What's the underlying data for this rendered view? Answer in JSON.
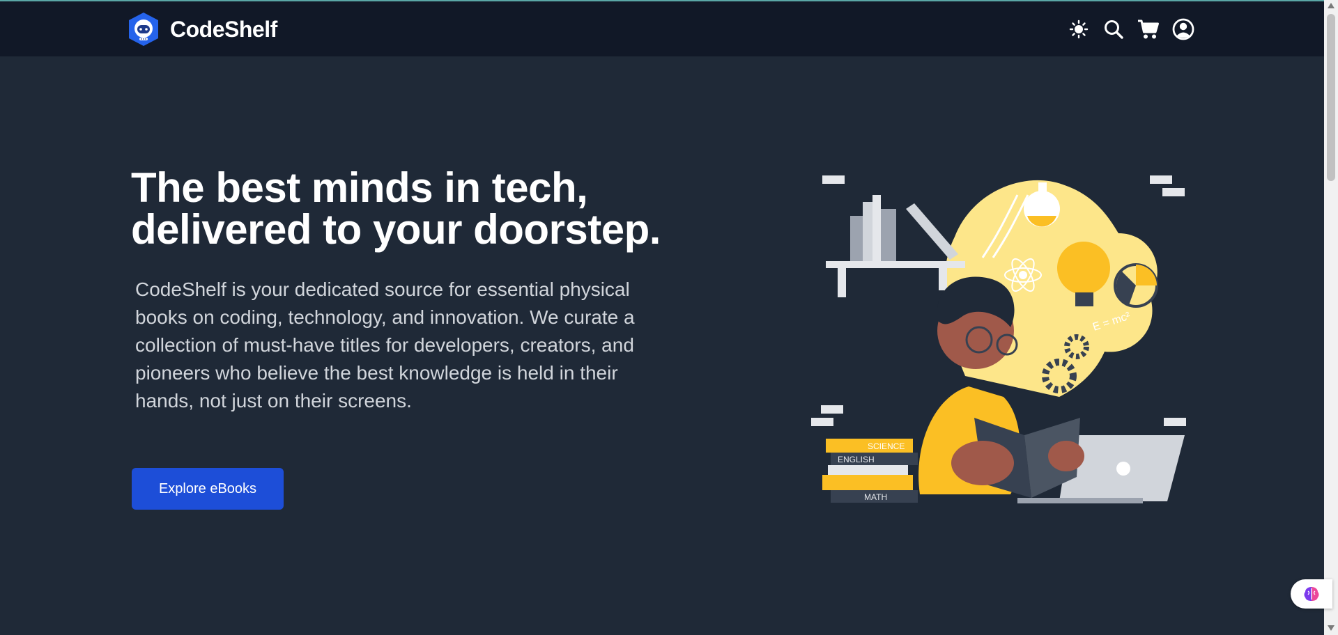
{
  "brand": {
    "name": "CodeShelf",
    "logo_icon": "astronaut-logo-icon"
  },
  "nav": {
    "icons": [
      "sun-icon",
      "search-icon",
      "cart-icon",
      "user-icon"
    ]
  },
  "hero": {
    "title_line1": "The best minds in tech,",
    "title_line2": "delivered to your doorstep.",
    "description": "CodeShelf is your dedicated source for essential physical books on coding, technology, and innovation. We curate a collection of must-have titles for developers, creators, and pioneers who believe the best knowledge is held in their hands, not just on their screens.",
    "cta_label": "Explore eBooks"
  },
  "illustration": {
    "book_labels": [
      "SCIENCE",
      "ENGLISH",
      "MATH"
    ],
    "formula": "E = mc²"
  },
  "colors": {
    "navbar": "#111827",
    "background": "#1f2937",
    "accent": "#1d4ed8",
    "illustration_yellow": "#fcd34d"
  }
}
